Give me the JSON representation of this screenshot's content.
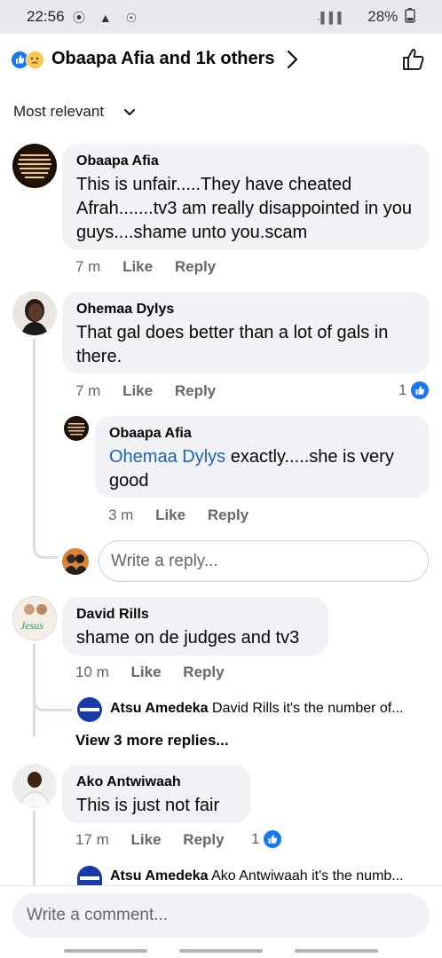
{
  "status_bar": {
    "time": "22:56",
    "left_icons": "⦿ ▲ ☉",
    "signal": "⸳▌▌▌",
    "battery": "28%"
  },
  "header": {
    "title": "Obaapa Afia and 1k others",
    "reaction_icons": [
      "like-reaction-icon",
      "sad-reaction-icon"
    ]
  },
  "sort": {
    "label": "Most relevant"
  },
  "comments": [
    {
      "author": "Obaapa Afia",
      "text": "This is unfair.....They have cheated Afrah.......tv3 am really disappointed in you guys....shame unto you.scam",
      "time": "7 m",
      "like_label": "Like",
      "reply_label": "Reply"
    },
    {
      "author": "Ohemaa Dylys",
      "text": "That gal does better than a lot of gals in there.",
      "time": "7 m",
      "like_label": "Like",
      "reply_label": "Reply",
      "reaction_count": "1",
      "replies": [
        {
          "author": "Obaapa Afia",
          "mention": "Ohemaa Dylys",
          "text": " exactly.....she is very good",
          "time": "3 m",
          "like_label": "Like",
          "reply_label": "Reply"
        }
      ],
      "reply_placeholder": "Write a reply..."
    },
    {
      "author": "David Rills",
      "text": "shame on de judges and tv3",
      "time": "10 m",
      "like_label": "Like",
      "reply_label": "Reply",
      "latest_reply": {
        "author": "Atsu Amedeka",
        "text": " David Rills it's the number of..."
      },
      "more_replies": "View 3 more replies..."
    },
    {
      "author": "Ako Antwiwaah",
      "text": "This is just not fair",
      "time": "17 m",
      "like_label": "Like",
      "reply_label": "Reply",
      "reaction_count": "1",
      "latest_reply": {
        "author": "Atsu Amedeka",
        "text": " Ako Antwiwaah it's the numb..."
      }
    }
  ],
  "composer": {
    "placeholder": "Write a comment..."
  },
  "colors": {
    "facebook_blue": "#1877f2",
    "bubble_bg": "#f0f2f5",
    "meta_gray": "#65676b",
    "mention_blue": "#1b64b8"
  }
}
